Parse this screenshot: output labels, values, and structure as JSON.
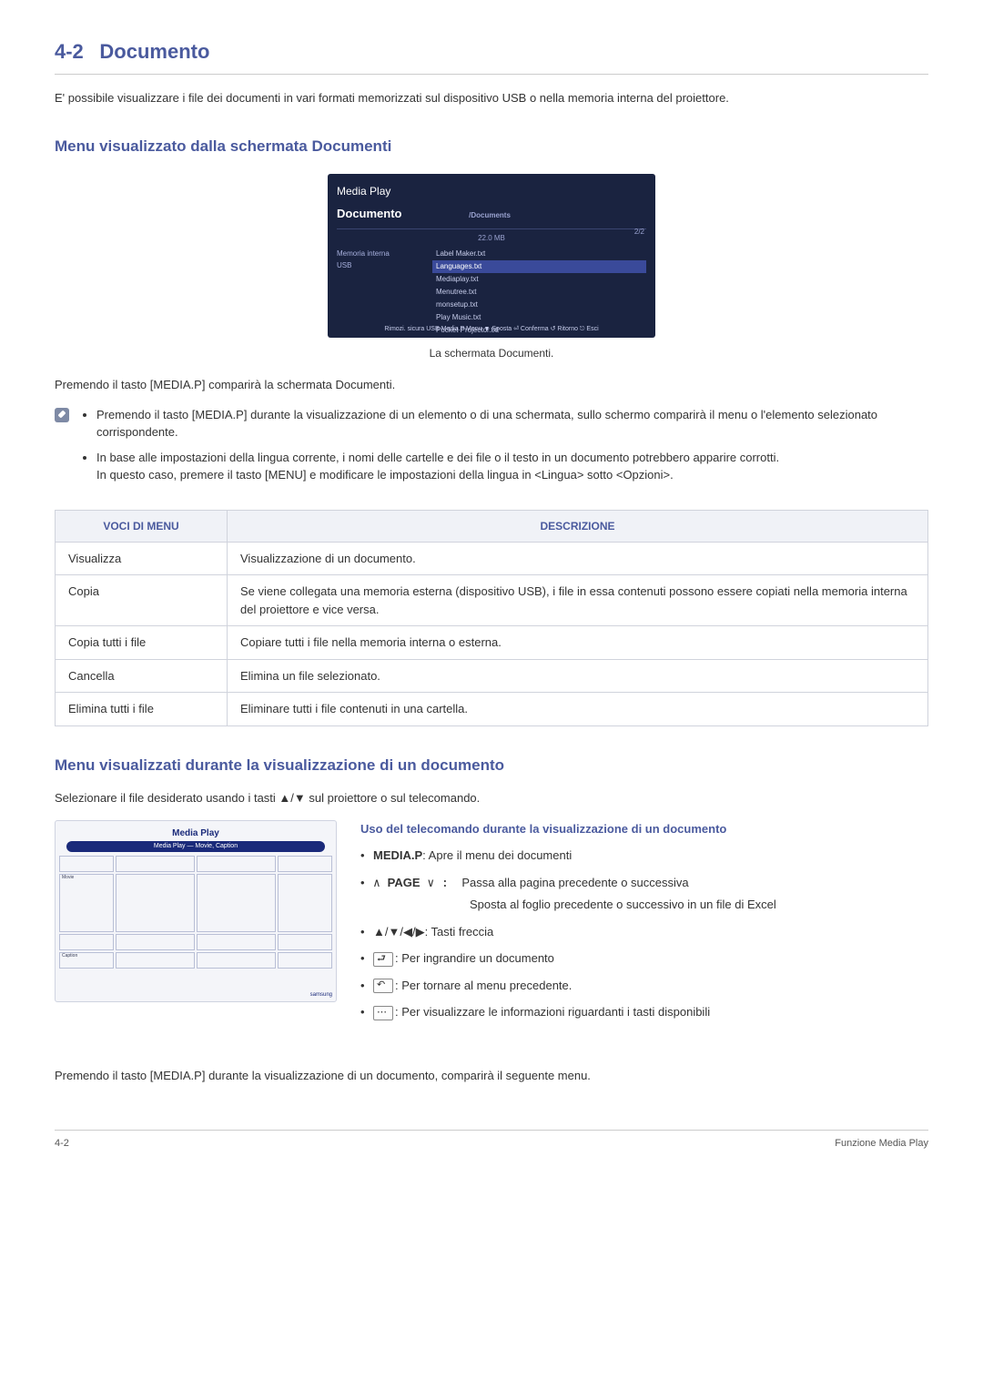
{
  "section": {
    "number": "4-2",
    "title": "Documento"
  },
  "intro": "E' possibile visualizzare i file dei documenti in vari formati memorizzati sul dispositivo USB o nella memoria interna del proiettore.",
  "h2_1": "Menu visualizzato dalla schermata Documenti",
  "screenshot1": {
    "title": "Media Play",
    "subtitle": "Documento",
    "path": "/Documents",
    "size": "22.0 MB",
    "page": "2/2",
    "sources": [
      "Memoria interna",
      "USB"
    ],
    "files": [
      "Label Maker.txt",
      "Languages.txt",
      "Mediaplay.txt",
      "Menutree.txt",
      "monsetup.txt",
      "Play Music.txt",
      "Pocket Projector.txt"
    ],
    "highlighted": 1,
    "footer": "Rimozi. sicura USB   Media.P Menu  ▼ Sposta  ⏎ Conferma  ↺ Ritorno  ⎋ Esci"
  },
  "caption1": "La schermata Documenti.",
  "para_after_shot": "Premendo il tasto [MEDIA.P] comparirà la schermata Documenti.",
  "note_bullets": [
    "Premendo il tasto [MEDIA.P] durante la visualizzazione di un elemento o di una schermata, sullo schermo comparirà il menu o l'elemento selezionato corrispondente.",
    "In base alle impostazioni della lingua corrente, i nomi delle cartelle e dei file o il testo in un documento potrebbero apparire corrotti.\nIn questo caso, premere il tasto [MENU] e modificare le impostazioni della lingua in <Lingua> sotto <Opzioni>."
  ],
  "table": {
    "head": [
      "VOCI DI MENU",
      "DESCRIZIONE"
    ],
    "rows": [
      [
        "Visualizza",
        "Visualizzazione di un documento."
      ],
      [
        "Copia",
        "Se viene collegata una memoria esterna (dispositivo USB), i file in essa contenuti possono essere copiati nella memoria interna del proiettore e vice versa."
      ],
      [
        "Copia tutti i file",
        "Copiare tutti i file nella memoria interna o esterna."
      ],
      [
        "Cancella",
        "Elimina un file selezionato."
      ],
      [
        "Elimina tutti i file",
        "Eliminare tutti i file contenuti in una cartella."
      ]
    ]
  },
  "h2_2": "Menu visualizzati durante la visualizzazione di un documento",
  "para_select": "Selezionare il file desiderato usando i tasti ▲/▼ sul proiettore o sul telecomando.",
  "screenshot2": {
    "title": "Media Play",
    "sub": "Media Play — Movie, Caption",
    "corner": "samsung"
  },
  "remote": {
    "heading": "Uso del telecomando durante la visualizzazione di un documento",
    "items": {
      "mediap_label": "MEDIA.P",
      "mediap_text": ": Apre il menu dei documenti",
      "page_prefix": "∧ ",
      "page_label": "PAGE",
      "page_suffix": " ∨ :",
      "page_text": "Passa alla pagina precedente o successiva",
      "page_sub": "Sposta al foglio precedente o successivo in un file di Excel",
      "arrows": "▲/▼/◀/▶: Tasti freccia",
      "enter": ": Per ingrandire un documento",
      "back": ": Per tornare al menu precedente.",
      "info": ": Per visualizzare le informazioni riguardanti i tasti disponibili"
    }
  },
  "closing": "Premendo il tasto [MEDIA.P] durante la visualizzazione di un documento, comparirà il seguente menu.",
  "footer": {
    "left": "4-2",
    "right": "Funzione Media Play"
  }
}
